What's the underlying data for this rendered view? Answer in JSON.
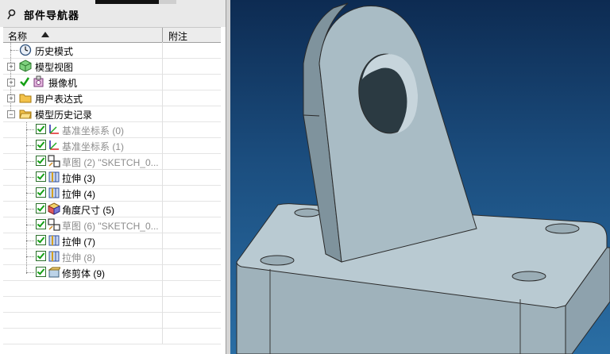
{
  "navigator": {
    "title": "部件导航器",
    "columns": {
      "name": "名称",
      "notes": "附注"
    },
    "items": [
      {
        "label": "历史模式"
      },
      {
        "label": "模型视图"
      },
      {
        "label": "摄像机"
      },
      {
        "label": "用户表达式"
      },
      {
        "label": "模型历史记录"
      },
      {
        "label": "基准坐标系 (0)"
      },
      {
        "label": "基准坐标系 (1)"
      },
      {
        "label": "草图 (2) \"SKETCH_0..."
      },
      {
        "label": "拉伸 (3)"
      },
      {
        "label": "拉伸 (4)"
      },
      {
        "label": "角度尺寸 (5)"
      },
      {
        "label": "草图 (6) \"SKETCH_0..."
      },
      {
        "label": "拉伸 (7)"
      },
      {
        "label": "拉伸 (8)"
      },
      {
        "label": "修剪体 (9)"
      }
    ]
  },
  "icons": {
    "pin": "pin-icon",
    "history": "clock-icon",
    "model_views": "cube-view-icon",
    "camera": "camera-icon",
    "folder": "folder-icon",
    "csys": "datum-csys-icon",
    "sketch": "sketch-icon",
    "extrude": "extrude-icon",
    "angle": "angle-dimension-icon",
    "trim": "trim-body-icon",
    "check": "checkmark-icon"
  },
  "colors": {
    "graphics_bg_top": "#0d2b52",
    "graphics_bg_bottom": "#2a6ea4",
    "model_face": "#b4c6cf",
    "model_side": "#8ea2ad",
    "check_green": "#14a014",
    "dim_text": "#8c8c8c"
  }
}
